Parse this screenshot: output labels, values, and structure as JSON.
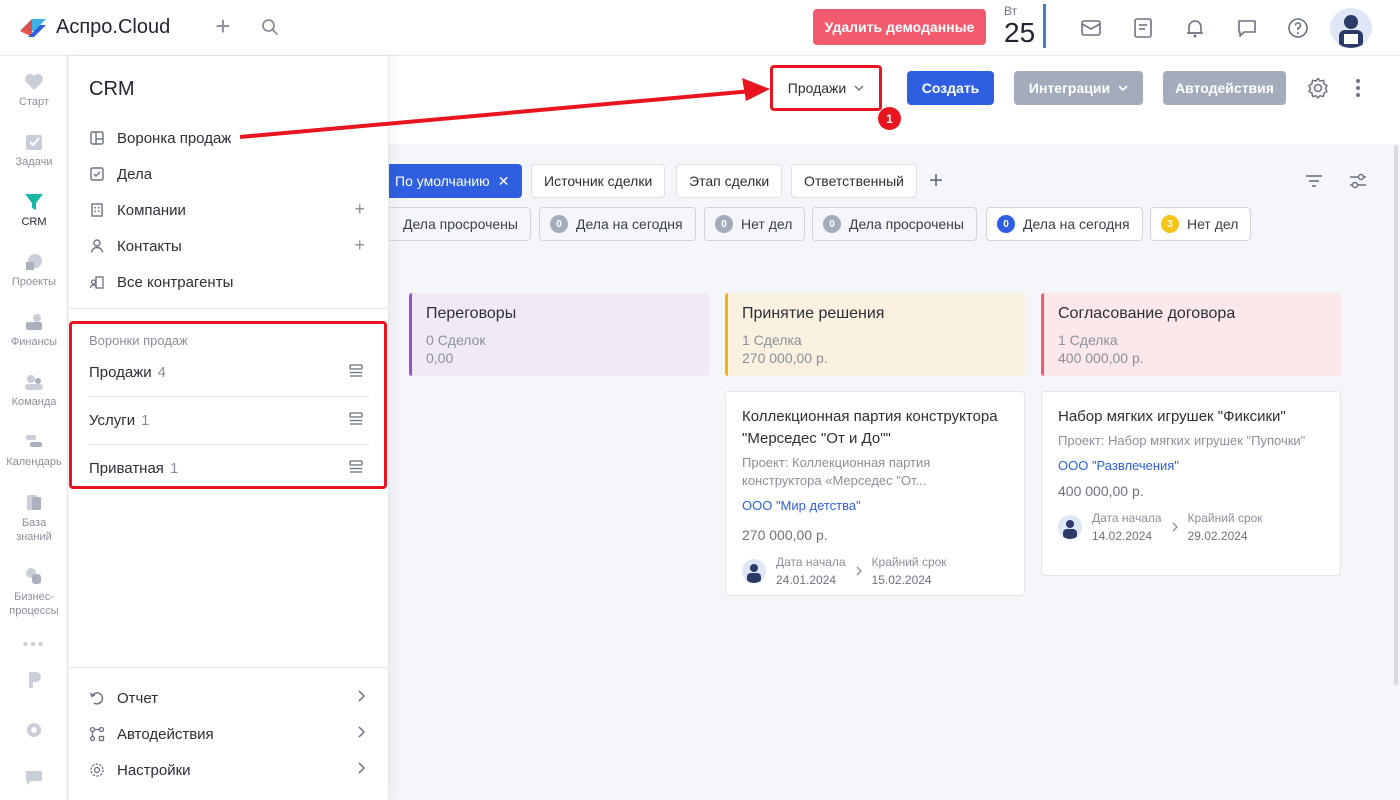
{
  "app": {
    "logo_text": "Аспро.Cloud"
  },
  "topbar": {
    "demo_button": "Удалить демоданные",
    "date_weekday": "Вт",
    "date_day": "25"
  },
  "rail": {
    "items": [
      {
        "label": "Старт"
      },
      {
        "label": "Задачи"
      },
      {
        "label": "CRM"
      },
      {
        "label": "Проекты"
      },
      {
        "label": "Финансы"
      },
      {
        "label": "Команда"
      },
      {
        "label": "Календарь"
      },
      {
        "label": "База знаний"
      },
      {
        "label": "Бизнес-процессы"
      }
    ]
  },
  "panel": {
    "title": "CRM",
    "menu": [
      {
        "label": "Воронка продаж"
      },
      {
        "label": "Дела"
      },
      {
        "label": "Компании"
      },
      {
        "label": "Контакты"
      },
      {
        "label": "Все контрагенты"
      }
    ],
    "funnels_label": "Воронки продаж",
    "funnels": [
      {
        "label": "Продажи",
        "count": "4"
      },
      {
        "label": "Услуги",
        "count": "1"
      },
      {
        "label": "Приватная",
        "count": "1"
      }
    ],
    "bottom_menu": [
      {
        "label": "Отчет"
      },
      {
        "label": "Автодействия"
      },
      {
        "label": "Настройки"
      }
    ]
  },
  "toolbar": {
    "funnel_select": "Продажи",
    "annotation_badge": "1",
    "create": "Создать",
    "integrations": "Интеграции",
    "autoactions": "Автодействия"
  },
  "filters": {
    "default_chip": "По умолчанию",
    "chips": [
      "Источник сделки",
      "Этап сделки",
      "Ответственный"
    ]
  },
  "stats": [
    {
      "count": "",
      "label": "Дела просрочены"
    },
    {
      "count": "0",
      "label": "Дела на сегодня"
    },
    {
      "count": "0",
      "label": "Нет дел"
    },
    {
      "count": "0",
      "label": "Дела просрочены"
    },
    {
      "count": "0",
      "label": "Дела на сегодня"
    },
    {
      "count": "3",
      "label": "Нет дел"
    }
  ],
  "columns": [
    {
      "title": "Переговоры",
      "count": "0 Сделок",
      "sum": "0,00",
      "color": "#9b51c7",
      "bg": "#f1e9f6"
    },
    {
      "title": "Принятие решения",
      "count": "1 Сделка",
      "sum": "270 000,00 р.",
      "color": "#f5b400",
      "bg": "#faf1e0"
    },
    {
      "title": "Согласование договора",
      "count": "1 Сделка",
      "sum": "400 000,00 р.",
      "color": "#f25b6e",
      "bg": "#fbe8eb"
    }
  ],
  "deals": [
    {
      "title": "Коллекционная партия конструктора \"Мерседес \"От и До\"\"",
      "project": "Проект: Коллекционная партия конструктора «Мерседес \"От...",
      "company": "ООО \"Мир детства\"",
      "sum": "270 000,00 р.",
      "start_label": "Дата начала",
      "start": "24.01.2024",
      "due_label": "Крайний срок",
      "due": "15.02.2024"
    },
    {
      "title": "Набор мягких игрушек \"Фиксики\"",
      "project": "Проект: Набор мягких игрушек \"Пупочки\"",
      "company": "ООО \"Развлечения\"",
      "sum": "400 000,00 р.",
      "start_label": "Дата начала",
      "start": "14.02.2024",
      "due_label": "Крайний срок",
      "due": "29.02.2024"
    }
  ]
}
